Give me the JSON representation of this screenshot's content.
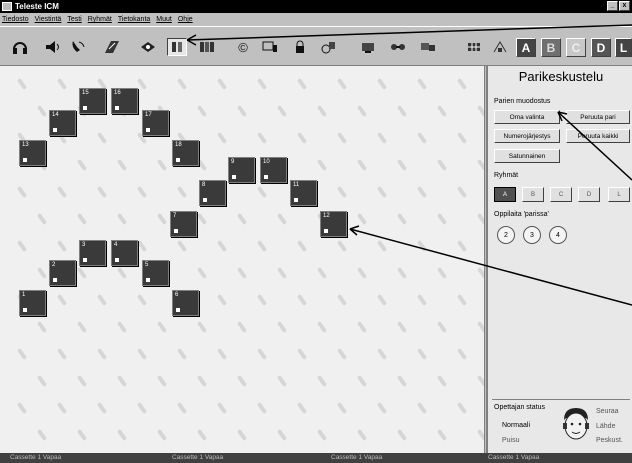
{
  "window": {
    "title": "Teleste ICM",
    "min": "_",
    "close": "x"
  },
  "menu": [
    "Tiedosto",
    "Viestintä",
    "Testi",
    "Ryhmät",
    "Tietokanta",
    "Muut",
    "Ohje"
  ],
  "toolbar": {
    "icons": [
      "headset-icon",
      "speaker-icon",
      "phone-icon",
      "tape-icon",
      "eye-icon",
      "pairs-icon",
      "group-icon",
      "copyright-icon",
      "monitor-icon",
      "lock-icon",
      "cd-icon",
      "camera-icon",
      "video-icon",
      "users-icon",
      "recorder-icon",
      "grid-icon",
      "tree-icon"
    ],
    "copyright_glyph": "©",
    "groups": [
      "A",
      "B",
      "C",
      "D",
      "L"
    ]
  },
  "seats": [
    {
      "label": "1"
    },
    {
      "label": "2"
    },
    {
      "label": "3"
    },
    {
      "label": "4"
    },
    {
      "label": "5"
    },
    {
      "label": "6"
    },
    {
      "label": "7"
    },
    {
      "label": "8"
    },
    {
      "label": "9"
    },
    {
      "label": "10"
    },
    {
      "label": "11"
    },
    {
      "label": "12"
    },
    {
      "label": "13"
    },
    {
      "label": "14"
    },
    {
      "label": "15"
    },
    {
      "label": "16"
    },
    {
      "label": "17"
    },
    {
      "label": "18"
    }
  ],
  "panel": {
    "title": "Parikeskustelu",
    "pairing_label": "Parien muodostus",
    "buttons": {
      "own": "Oma valinta",
      "cancel_pair": "Peruuta pari",
      "number_order": "Numerojärjestys",
      "cancel_all": "Peruuta kaikki",
      "random": "Satunnainen"
    },
    "groups_label": "Ryhmät",
    "groups": [
      "A",
      "B",
      "C",
      "D",
      "L"
    ],
    "pupils_label": "Oppilaita 'parissa'",
    "pupil_counts": [
      "2",
      "3",
      "4"
    ],
    "teacher_status_label": "Opettajan status",
    "teacher_left": [
      "Normaali",
      "Puisu"
    ],
    "teacher_right": [
      "Seuraa",
      "Lähde",
      "Peskust."
    ]
  },
  "status_strip": [
    "Cassette 1  Vapaa",
    "Cassette 1  Vapaa",
    "Cassette 1  Vapaa",
    "Cassette 1  Vapaa"
  ]
}
